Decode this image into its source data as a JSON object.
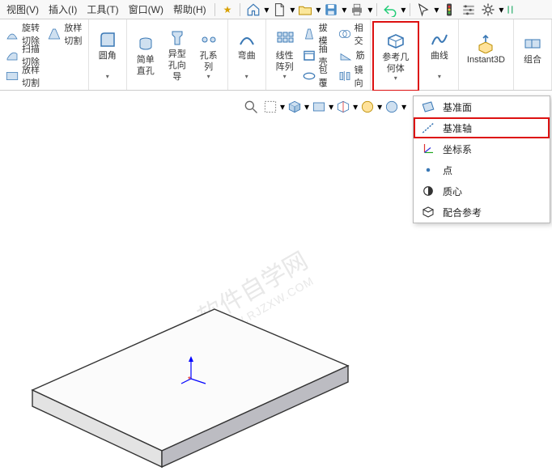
{
  "menu": {
    "view": "视图(V)",
    "insert": "插入(I)",
    "tools": "工具(T)",
    "window": "窗口(W)",
    "help": "帮助(H)"
  },
  "ribbon": {
    "rotate_cut": "旋转切除",
    "loft_cut": "放样切割",
    "sweep_cut": "扫描切除",
    "loft_cut2": "放样切割",
    "fillet": "圆角",
    "simple_hole": "简单直孔",
    "profile_hole": "异型孔向导",
    "hole_series": "孔系列",
    "bend": "弯曲",
    "linear_pattern": "线性阵列",
    "draft": "拔模",
    "shell": "抽壳",
    "wrap": "包覆",
    "intersect": "相交",
    "rib": "筋",
    "mirror": "镜向",
    "ref_geo": "参考几何体",
    "curves": "曲线",
    "instant3d": "Instant3D",
    "combine": "组合"
  },
  "dropdown": {
    "plane": "基准面",
    "axis": "基准轴",
    "csys": "坐标系",
    "point": "点",
    "com": "质心",
    "mate_ref": "配合参考"
  },
  "watermark": {
    "l1": "软件自学网",
    "l2": "WWW.RJZXW.COM"
  }
}
